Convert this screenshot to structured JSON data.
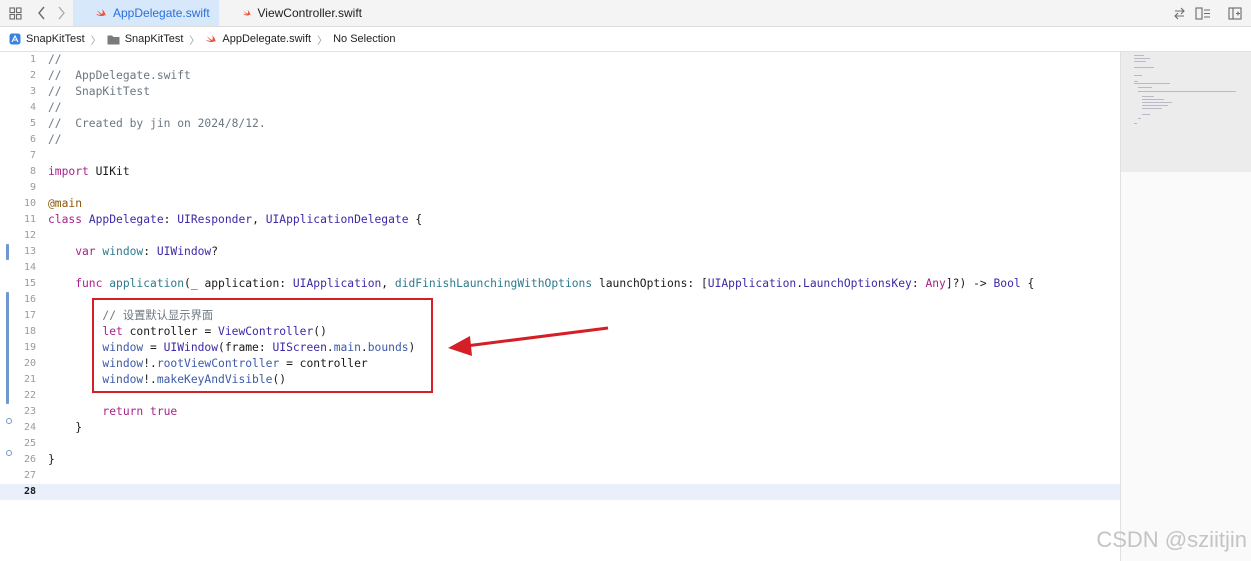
{
  "tabs": [
    {
      "label": "AppDelegate.swift",
      "active": true
    },
    {
      "label": "ViewController.swift",
      "active": false
    }
  ],
  "breadcrumbs": [
    {
      "label": "SnapKitTest",
      "icon": "app-icon"
    },
    {
      "label": "SnapKitTest",
      "icon": "folder-icon"
    },
    {
      "label": "AppDelegate.swift",
      "icon": "swift-icon"
    },
    {
      "label": "No Selection",
      "icon": ""
    }
  ],
  "editor": {
    "current_line": 28,
    "line_numbers": [
      "1",
      "2",
      "3",
      "4",
      "5",
      "6",
      "7",
      "8",
      "9",
      "10",
      "11",
      "12",
      "13",
      "14",
      "15",
      "16",
      "17",
      "18",
      "19",
      "20",
      "21",
      "22",
      "23",
      "24",
      "25",
      "26",
      "27",
      "28"
    ]
  },
  "code": {
    "l1": "//",
    "l2": "//  AppDelegate.swift",
    "l3": "//  SnapKitTest",
    "l4": "//",
    "l5": "//  Created by jin on 2024/8/12.",
    "l6": "//",
    "l8_kw": "import",
    "l8_rest": " UIKit",
    "l10": "@main",
    "l11_kw": "class",
    "l11_name": " AppDelegate",
    "l11_colon": ": ",
    "l11_t1": "UIResponder",
    "l11_comma": ", ",
    "l11_t2": "UIApplicationDelegate",
    "l11_end": " {",
    "l13_kw": "    var",
    "l13_name": " window",
    "l13_colon": ": ",
    "l13_type": "UIWindow",
    "l13_end": "?",
    "l15_kw": "    func",
    "l15_fn": " application",
    "l15_a": "(_ application: ",
    "l15_t1": "UIApplication",
    "l15_b": ", ",
    "l15_fn2": "didFinishLaunchingWithOptions",
    "l15_c": " launchOptions: [",
    "l15_t2": "UIApplication",
    "l15_d": ".",
    "l15_t3": "LaunchOptionsKey",
    "l15_e": ": ",
    "l15_kw2": "Any",
    "l15_f": "]?) -> ",
    "l15_t4": "Bool",
    "l15_g": " {",
    "l17": "        // 设置默认显示界面",
    "l18_kw": "        let",
    "l18_a": " controller = ",
    "l18_t": "ViewController",
    "l18_b": "()",
    "l19_a": "        window",
    "l19_b": " = ",
    "l19_t1": "UIWindow",
    "l19_c": "(frame: ",
    "l19_t2": "UIScreen",
    "l19_d": ".",
    "l19_m1": "main",
    "l19_e": ".",
    "l19_m2": "bounds",
    "l19_f": ")",
    "l20_a": "        window",
    "l20_b": "!.",
    "l20_m": "rootViewController",
    "l20_c": " = controller",
    "l21_a": "        window",
    "l21_b": "!.",
    "l21_m": "makeKeyAndVisible",
    "l21_c": "()",
    "l23_kw": "        return",
    "l23_v": " true",
    "l24": "    }",
    "l26": "}"
  },
  "watermark": "CSDN @sziitjin"
}
